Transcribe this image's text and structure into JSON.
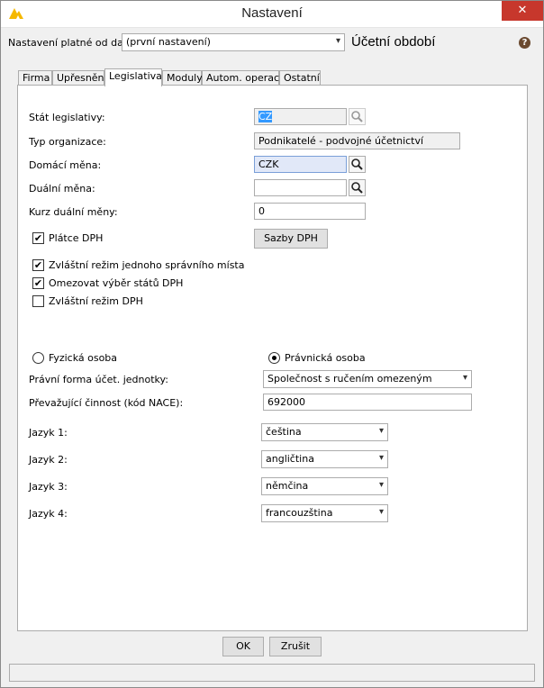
{
  "window": {
    "title": "Nastavení",
    "close_glyph": "✕"
  },
  "header": {
    "valid_from_label": "Nastavení platné od data:",
    "valid_from_value": "(první nastavení)",
    "period_title": "Účetní období",
    "help_glyph": "?"
  },
  "tabs": [
    {
      "label": "Firma",
      "active": false
    },
    {
      "label": "Upřesnění",
      "active": false
    },
    {
      "label": "Legislativa",
      "active": true
    },
    {
      "label": "Moduly",
      "active": false
    },
    {
      "label": "Autom. operace",
      "active": false
    },
    {
      "label": "Ostatní",
      "active": false
    }
  ],
  "legislativa": {
    "state_label": "Stát legislativy:",
    "state_value": "CZ",
    "org_type_label": "Typ organizace:",
    "org_type_value": "Podnikatelé - podvojné účetnictví",
    "home_currency_label": "Domácí měna:",
    "home_currency_value": "CZK",
    "dual_currency_label": "Duální měna:",
    "dual_currency_value": "",
    "dual_rate_label": "Kurz duální měny:",
    "dual_rate_value": "0",
    "vat_payer_label": "Plátce DPH",
    "vat_payer_checked": true,
    "vat_rates_button": "Sazby DPH",
    "moss_label": "Zvláštní režim jednoho správního místa",
    "moss_checked": true,
    "limit_states_label": "Omezovat výběr států DPH",
    "limit_states_checked": true,
    "special_vat_label": "Zvláštní režim DPH",
    "special_vat_checked": false,
    "person_natural_label": "Fyzická osoba",
    "person_natural_selected": false,
    "person_legal_label": "Právnická osoba",
    "person_legal_selected": true,
    "legal_form_label": "Právní forma účet. jednotky:",
    "legal_form_value": "Společnost s ručením omezeným",
    "nace_label": "Převažující činnost (kód NACE):",
    "nace_value": "692000",
    "languages": [
      {
        "label": "Jazyk 1:",
        "value": "čeština"
      },
      {
        "label": "Jazyk 2:",
        "value": "angličtina"
      },
      {
        "label": "Jazyk 3:",
        "value": "němčina"
      },
      {
        "label": "Jazyk 4:",
        "value": "francouzština"
      }
    ]
  },
  "footer": {
    "ok_label": "OK",
    "cancel_label": "Zrušit"
  },
  "icons": {
    "dropdown": "chevron-down-icon",
    "search": "magnifier-icon",
    "check": "✔"
  },
  "colors": {
    "close": "#c7372c",
    "selection": "#3399ff",
    "logo": "#f5b800"
  }
}
